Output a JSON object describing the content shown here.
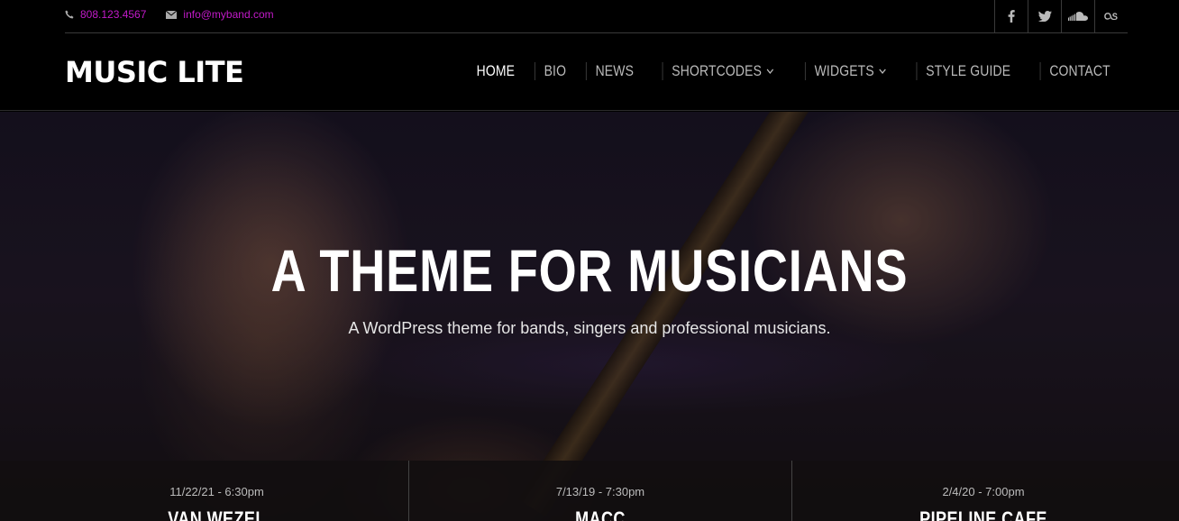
{
  "topbar": {
    "phone": "808.123.4567",
    "email": "info@myband.com",
    "social": [
      {
        "icon": "facebook-icon"
      },
      {
        "icon": "twitter-icon"
      },
      {
        "icon": "soundcloud-icon"
      },
      {
        "icon": "lastfm-icon"
      }
    ]
  },
  "header": {
    "logo": "MUSIC LITE",
    "nav": [
      {
        "label": "HOME",
        "active": true
      },
      {
        "label": "BIO"
      },
      {
        "label": "NEWS"
      },
      {
        "label": "SHORTCODES",
        "dropdown": true
      },
      {
        "label": "WIDGETS",
        "dropdown": true
      },
      {
        "label": "STYLE GUIDE"
      },
      {
        "label": "CONTACT"
      }
    ]
  },
  "hero": {
    "title": "A THEME FOR MUSICIANS",
    "subtitle": "A WordPress theme for bands, singers and professional musicians."
  },
  "events": [
    {
      "date": "11/22/21 - 6:30pm",
      "venue": "VAN WEZEL"
    },
    {
      "date": "7/13/19 - 7:30pm",
      "venue": "MACC"
    },
    {
      "date": "2/4/20 - 7:00pm",
      "venue": "PIPELINE CAFE"
    }
  ],
  "colors": {
    "accent": "#c21ac9",
    "background": "#000000"
  }
}
